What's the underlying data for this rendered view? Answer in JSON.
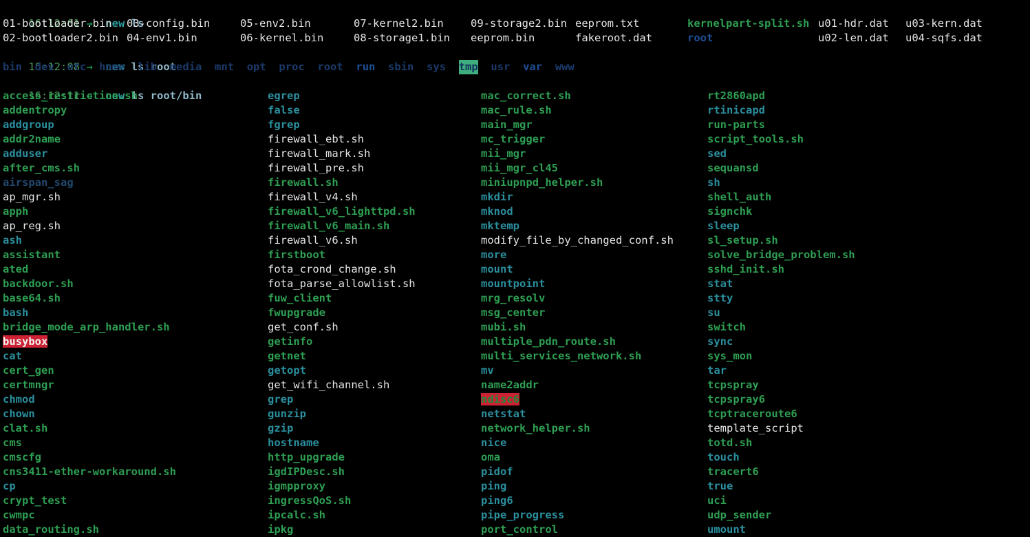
{
  "terminal": {
    "background": "#000000",
    "palette": {
      "file": "#e6e6e6",
      "executable": "#2e9e52",
      "symlink": "#2b8f9e",
      "directory": "#1b3a6b",
      "timestamp": "#4e9a5f",
      "arrow": "#14b362",
      "highlight_red_bg": "#cc2233",
      "highlight_green_bg": "#3fae7e"
    }
  },
  "prompts": [
    {
      "time": "16:12:01",
      "arrow": "→",
      "command": "new",
      "args": "ls"
    },
    {
      "time": "16:12:08",
      "arrow": "→",
      "command": "new",
      "args": "ls root"
    },
    {
      "time": "16:12:11",
      "arrow": "→",
      "command": "new",
      "args": "ls root/bin"
    }
  ],
  "output_ls": {
    "rows": [
      [
        {
          "name": "01-bootloader.bin",
          "type": "file"
        },
        {
          "name": "03-config.bin",
          "type": "file"
        },
        {
          "name": "05-env2.bin",
          "type": "file"
        },
        {
          "name": "07-kernel2.bin",
          "type": "file"
        },
        {
          "name": "09-storage2.bin",
          "type": "file"
        },
        {
          "name": "eeprom.txt",
          "type": "file"
        },
        {
          "name": "kernelpart-split.sh",
          "type": "executable"
        },
        {
          "name": "u01-hdr.dat",
          "type": "file"
        },
        {
          "name": "u03-kern.dat",
          "type": "file"
        }
      ],
      [
        {
          "name": "02-bootloader2.bin",
          "type": "file"
        },
        {
          "name": "04-env1.bin",
          "type": "file"
        },
        {
          "name": "06-kernel.bin",
          "type": "file"
        },
        {
          "name": "08-storage1.bin",
          "type": "file"
        },
        {
          "name": "eeprom.bin",
          "type": "file"
        },
        {
          "name": "fakeroot.dat",
          "type": "file"
        },
        {
          "name": "root",
          "type": "directory-bright"
        },
        {
          "name": "u02-len.dat",
          "type": "file"
        },
        {
          "name": "u04-sqfs.dat",
          "type": "file"
        }
      ]
    ]
  },
  "output_ls_root": {
    "entries": [
      {
        "name": "bin",
        "type": "directory"
      },
      {
        "name": "dev",
        "type": "directory"
      },
      {
        "name": "etc",
        "type": "directory"
      },
      {
        "name": "home",
        "type": "directory"
      },
      {
        "name": "lib",
        "type": "directory"
      },
      {
        "name": "media",
        "type": "directory"
      },
      {
        "name": "mnt",
        "type": "directory"
      },
      {
        "name": "opt",
        "type": "directory"
      },
      {
        "name": "proc",
        "type": "directory"
      },
      {
        "name": "root",
        "type": "directory"
      },
      {
        "name": "run",
        "type": "directory-bright"
      },
      {
        "name": "sbin",
        "type": "directory"
      },
      {
        "name": "sys",
        "type": "directory"
      },
      {
        "name": "tmp",
        "type": "directory-sticky"
      },
      {
        "name": "usr",
        "type": "directory"
      },
      {
        "name": "var",
        "type": "directory-bright"
      },
      {
        "name": "www",
        "type": "directory"
      }
    ]
  },
  "output_ls_root_bin": {
    "columns": [
      [
        {
          "name": "access_restriction.sh",
          "type": "executable"
        },
        {
          "name": "addentropy",
          "type": "executable"
        },
        {
          "name": "addgroup",
          "type": "symlink"
        },
        {
          "name": "addr2name",
          "type": "executable"
        },
        {
          "name": "adduser",
          "type": "symlink"
        },
        {
          "name": "after_cms.sh",
          "type": "executable"
        },
        {
          "name": "airspan_sag",
          "type": "dim"
        },
        {
          "name": "ap_mgr.sh",
          "type": "file"
        },
        {
          "name": "apph",
          "type": "executable"
        },
        {
          "name": "ap_reg.sh",
          "type": "file"
        },
        {
          "name": "ash",
          "type": "symlink"
        },
        {
          "name": "assistant",
          "type": "executable"
        },
        {
          "name": "ated",
          "type": "executable"
        },
        {
          "name": "backdoor.sh",
          "type": "executable"
        },
        {
          "name": "base64.sh",
          "type": "executable"
        },
        {
          "name": "bash",
          "type": "symlink"
        },
        {
          "name": "bridge_mode_arp_handler.sh",
          "type": "executable"
        },
        {
          "name": "busybox",
          "type": "highlight-red"
        },
        {
          "name": "cat",
          "type": "symlink"
        },
        {
          "name": "cert_gen",
          "type": "executable"
        },
        {
          "name": "certmngr",
          "type": "executable"
        },
        {
          "name": "chmod",
          "type": "symlink"
        },
        {
          "name": "chown",
          "type": "symlink"
        },
        {
          "name": "clat.sh",
          "type": "executable"
        },
        {
          "name": "cms",
          "type": "executable"
        },
        {
          "name": "cmscfg",
          "type": "executable"
        },
        {
          "name": "cns3411-ether-workaround.sh",
          "type": "executable"
        },
        {
          "name": "cp",
          "type": "symlink"
        },
        {
          "name": "crypt_test",
          "type": "executable"
        },
        {
          "name": "cwmpc",
          "type": "executable"
        },
        {
          "name": "data_routing.sh",
          "type": "executable"
        }
      ],
      [
        {
          "name": "egrep",
          "type": "symlink"
        },
        {
          "name": "false",
          "type": "symlink"
        },
        {
          "name": "fgrep",
          "type": "symlink"
        },
        {
          "name": "firewall_ebt.sh",
          "type": "file"
        },
        {
          "name": "firewall_mark.sh",
          "type": "file"
        },
        {
          "name": "firewall_pre.sh",
          "type": "file"
        },
        {
          "name": "firewall.sh",
          "type": "executable"
        },
        {
          "name": "firewall_v4.sh",
          "type": "file"
        },
        {
          "name": "firewall_v6_lighttpd.sh",
          "type": "executable"
        },
        {
          "name": "firewall_v6_main.sh",
          "type": "executable"
        },
        {
          "name": "firewall_v6.sh",
          "type": "file"
        },
        {
          "name": "firstboot",
          "type": "executable"
        },
        {
          "name": "fota_crond_change.sh",
          "type": "file"
        },
        {
          "name": "fota_parse_allowlist.sh",
          "type": "file"
        },
        {
          "name": "fuw_client",
          "type": "executable"
        },
        {
          "name": "fwupgrade",
          "type": "executable"
        },
        {
          "name": "get_conf.sh",
          "type": "file"
        },
        {
          "name": "getinfo",
          "type": "executable"
        },
        {
          "name": "getnet",
          "type": "executable"
        },
        {
          "name": "getopt",
          "type": "symlink"
        },
        {
          "name": "get_wifi_channel.sh",
          "type": "file"
        },
        {
          "name": "grep",
          "type": "symlink"
        },
        {
          "name": "gunzip",
          "type": "symlink"
        },
        {
          "name": "gzip",
          "type": "symlink"
        },
        {
          "name": "hostname",
          "type": "symlink"
        },
        {
          "name": "http_upgrade",
          "type": "executable"
        },
        {
          "name": "igdIPDesc.sh",
          "type": "executable"
        },
        {
          "name": "igmpproxy",
          "type": "executable"
        },
        {
          "name": "ingressQoS.sh",
          "type": "executable"
        },
        {
          "name": "ipcalc.sh",
          "type": "executable"
        },
        {
          "name": "ipkg",
          "type": "executable"
        }
      ],
      [
        {
          "name": "mac_correct.sh",
          "type": "executable"
        },
        {
          "name": "mac_rule.sh",
          "type": "executable"
        },
        {
          "name": "main_mgr",
          "type": "executable"
        },
        {
          "name": "mc_trigger",
          "type": "executable"
        },
        {
          "name": "mii_mgr",
          "type": "executable"
        },
        {
          "name": "mii_mgr_cl45",
          "type": "executable"
        },
        {
          "name": "miniupnpd_helper.sh",
          "type": "executable"
        },
        {
          "name": "mkdir",
          "type": "symlink"
        },
        {
          "name": "mknod",
          "type": "symlink"
        },
        {
          "name": "mktemp",
          "type": "symlink"
        },
        {
          "name": "modify_file_by_changed_conf.sh",
          "type": "file"
        },
        {
          "name": "more",
          "type": "symlink"
        },
        {
          "name": "mount",
          "type": "symlink"
        },
        {
          "name": "mountpoint",
          "type": "symlink"
        },
        {
          "name": "mrg_resolv",
          "type": "executable"
        },
        {
          "name": "msg_center",
          "type": "executable"
        },
        {
          "name": "mubi.sh",
          "type": "executable"
        },
        {
          "name": "multiple_pdn_route.sh",
          "type": "executable"
        },
        {
          "name": "multi_services_network.sh",
          "type": "executable"
        },
        {
          "name": "mv",
          "type": "symlink"
        },
        {
          "name": "name2addr",
          "type": "executable"
        },
        {
          "name": "ndisc6",
          "type": "highlight-red-green"
        },
        {
          "name": "netstat",
          "type": "symlink"
        },
        {
          "name": "network_helper.sh",
          "type": "executable"
        },
        {
          "name": "nice",
          "type": "symlink"
        },
        {
          "name": "oma",
          "type": "executable"
        },
        {
          "name": "pidof",
          "type": "symlink"
        },
        {
          "name": "ping",
          "type": "symlink"
        },
        {
          "name": "ping6",
          "type": "symlink"
        },
        {
          "name": "pipe_progress",
          "type": "symlink"
        },
        {
          "name": "port_control",
          "type": "executable"
        }
      ],
      [
        {
          "name": "rt2860apd",
          "type": "executable"
        },
        {
          "name": "rtinicapd",
          "type": "symlink"
        },
        {
          "name": "run-parts",
          "type": "executable"
        },
        {
          "name": "script_tools.sh",
          "type": "executable"
        },
        {
          "name": "sed",
          "type": "symlink"
        },
        {
          "name": "sequansd",
          "type": "executable"
        },
        {
          "name": "sh",
          "type": "symlink"
        },
        {
          "name": "shell_auth",
          "type": "executable"
        },
        {
          "name": "signchk",
          "type": "executable"
        },
        {
          "name": "sleep",
          "type": "symlink"
        },
        {
          "name": "sl_setup.sh",
          "type": "executable"
        },
        {
          "name": "solve_bridge_problem.sh",
          "type": "executable"
        },
        {
          "name": "sshd_init.sh",
          "type": "executable"
        },
        {
          "name": "stat",
          "type": "symlink"
        },
        {
          "name": "stty",
          "type": "symlink"
        },
        {
          "name": "su",
          "type": "symlink"
        },
        {
          "name": "switch",
          "type": "executable"
        },
        {
          "name": "sync",
          "type": "symlink"
        },
        {
          "name": "sys_mon",
          "type": "executable"
        },
        {
          "name": "tar",
          "type": "symlink"
        },
        {
          "name": "tcpspray",
          "type": "executable"
        },
        {
          "name": "tcpspray6",
          "type": "executable"
        },
        {
          "name": "tcptraceroute6",
          "type": "executable"
        },
        {
          "name": "template_script",
          "type": "file"
        },
        {
          "name": "totd.sh",
          "type": "executable"
        },
        {
          "name": "touch",
          "type": "symlink"
        },
        {
          "name": "tracert6",
          "type": "executable"
        },
        {
          "name": "true",
          "type": "symlink"
        },
        {
          "name": "uci",
          "type": "executable"
        },
        {
          "name": "udp_sender",
          "type": "executable"
        },
        {
          "name": "umount",
          "type": "symlink"
        }
      ]
    ]
  }
}
